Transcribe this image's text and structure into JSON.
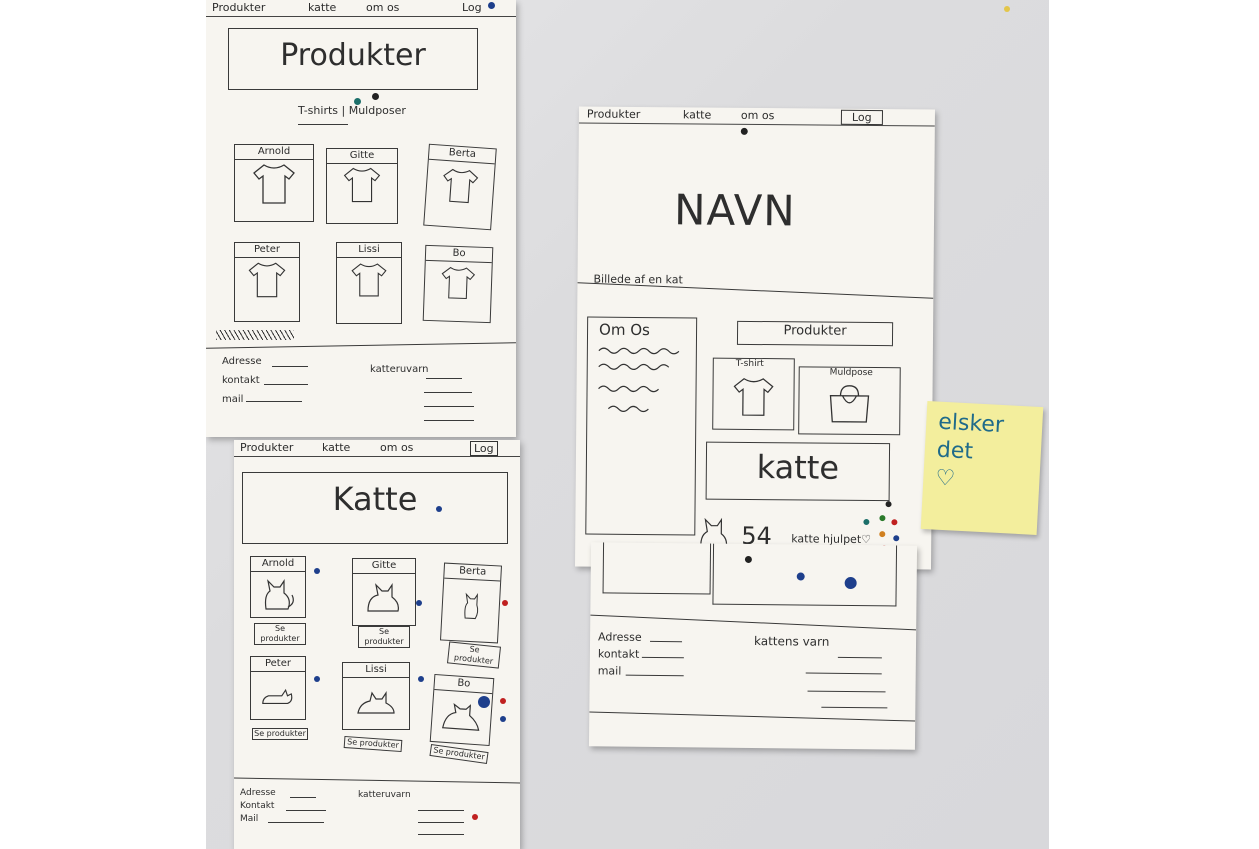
{
  "sheet1": {
    "nav": [
      "Produkter",
      "katte",
      "om os",
      "Log"
    ],
    "title": "Produkter",
    "tabs": "T-shirts | Muldposer",
    "cards": [
      "Arnold",
      "Gitte",
      "Berta",
      "Peter",
      "Lissi",
      "Bo"
    ],
    "footer_left": [
      "Adresse",
      "kontakt",
      "mail"
    ],
    "footer_right": "katteruvarn"
  },
  "sheet2": {
    "nav": [
      "Produkter",
      "katte",
      "om os",
      "Log"
    ],
    "title": "Katte",
    "cards": [
      "Arnold",
      "Gitte",
      "Berta",
      "Peter",
      "Lissi",
      "Bo"
    ],
    "button": "Se produkter",
    "footer_left": [
      "Adresse",
      "Kontakt",
      "Mail"
    ],
    "footer_right": "katteruvarn"
  },
  "sheet3": {
    "nav": [
      "Produkter",
      "katte",
      "om os",
      "Log"
    ],
    "hero": "NAVN",
    "hero_caption": "Billede af en kat",
    "about": "Om Os",
    "products": "Produkter",
    "tshirt": "T-shirt",
    "muldpose": "Muldpose",
    "katte": "katte",
    "count_num": "54",
    "count_text": "katte hjulpet♡",
    "footer_left": [
      "Adresse",
      "kontakt",
      "mail"
    ],
    "footer_right": "kattens varn"
  },
  "sticky": [
    "elsker",
    "det",
    "♡"
  ]
}
